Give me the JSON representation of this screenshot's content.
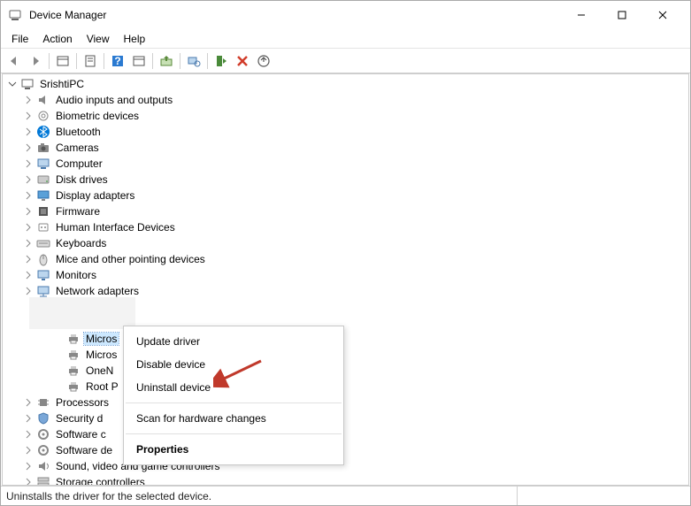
{
  "title": "Device Manager",
  "menu": {
    "file": "File",
    "action": "Action",
    "view": "View",
    "help": "Help"
  },
  "toolbar_icons": [
    "back-icon",
    "forward-icon",
    "sep",
    "show-hidden-icon",
    "sep",
    "properties-icon",
    "sep",
    "help-icon",
    "refresh-icon",
    "sep",
    "update-driver-icon",
    "sep",
    "scan-hardware-icon",
    "sep",
    "enable-device-icon",
    "uninstall-icon",
    "add-driver-icon"
  ],
  "root": {
    "name": "SrishtiPC"
  },
  "categories": [
    {
      "label": "Audio inputs and outputs",
      "icon": "audio-icon"
    },
    {
      "label": "Biometric devices",
      "icon": "biometric-icon"
    },
    {
      "label": "Bluetooth",
      "icon": "bluetooth-icon"
    },
    {
      "label": "Cameras",
      "icon": "camera-icon"
    },
    {
      "label": "Computer",
      "icon": "computer-icon"
    },
    {
      "label": "Disk drives",
      "icon": "disk-icon"
    },
    {
      "label": "Display adapters",
      "icon": "display-icon"
    },
    {
      "label": "Firmware",
      "icon": "firmware-icon"
    },
    {
      "label": "Human Interface Devices",
      "icon": "hid-icon"
    },
    {
      "label": "Keyboards",
      "icon": "keyboard-icon"
    },
    {
      "label": "Mice and other pointing devices",
      "icon": "mouse-icon"
    },
    {
      "label": "Monitors",
      "icon": "monitor-icon"
    },
    {
      "label": "Network adapters",
      "icon": "network-icon"
    }
  ],
  "printer_children": [
    {
      "label": "Micros",
      "icon": "printer-icon",
      "selected": true
    },
    {
      "label": "Micros",
      "icon": "printer-icon"
    },
    {
      "label": "OneN",
      "icon": "printer-icon"
    },
    {
      "label": "Root P",
      "icon": "printer-icon"
    }
  ],
  "categories_after": [
    {
      "label": "Processors",
      "icon": "processor-icon",
      "truncated": true
    },
    {
      "label": "Security d",
      "icon": "security-icon",
      "truncated": true
    },
    {
      "label": "Software c",
      "icon": "software-icon",
      "truncated": true
    },
    {
      "label": "Software de",
      "icon": "software-icon",
      "truncated": false
    },
    {
      "label": "Sound, video and game controllers",
      "icon": "sound-icon"
    },
    {
      "label": "Storage controllers",
      "icon": "storage-icon",
      "cut": true
    }
  ],
  "context_menu": {
    "update": "Update driver",
    "disable": "Disable device",
    "uninstall": "Uninstall device",
    "scan": "Scan for hardware changes",
    "properties": "Properties"
  },
  "status": "Uninstalls the driver for the selected device.",
  "colors": {
    "arrow": "#c0392b",
    "bluetooth": "#0078d7",
    "selection": "#cce8ff"
  }
}
